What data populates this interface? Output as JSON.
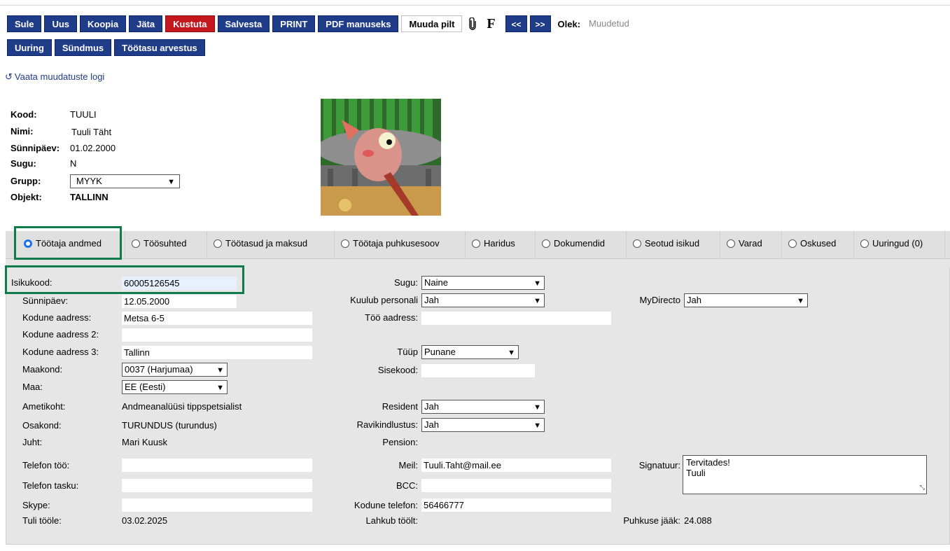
{
  "toolbar": {
    "row1": [
      "Sule",
      "Uus",
      "Koopia",
      "Jäta",
      "Kustuta",
      "Salvesta",
      "PRINT",
      "PDF manuseks"
    ],
    "muuda_pilt": "Muuda pilt",
    "attach_icon": "paperclip-icon",
    "f_label": "F",
    "prev": "<<",
    "next": ">>",
    "olek_label": "Olek:",
    "olek_value": "Muudetud",
    "row2": [
      "Uuring",
      "Sündmus",
      "Töötasu arvestus"
    ]
  },
  "colors": {
    "primary": "#1f3c88",
    "danger": "#c4161c",
    "highlight": "#0f7a4b"
  },
  "log_link": {
    "icon": "history-icon",
    "label": "Vaata muudatuste logi"
  },
  "header": {
    "kood_label": "Kood:",
    "kood": "TUULI",
    "nimi_label": "Nimi:",
    "nimi": "Tuuli Täht",
    "sunnipaev_label": "Sünnipäev:",
    "sunnipaev": "01.02.2000",
    "sugu_label": "Sugu:",
    "sugu": "N",
    "grupp_label": "Grupp:",
    "grupp": "MYYK",
    "objekt_label": "Objekt:",
    "objekt": "TALLINN"
  },
  "tabs": [
    {
      "label": "Töötaja andmed",
      "selected": true
    },
    {
      "label": "Töösuhted",
      "selected": false
    },
    {
      "label": "Töötasud ja maksud",
      "selected": false
    },
    {
      "label": "Töötaja puhkusesoov",
      "selected": false
    },
    {
      "label": "Haridus",
      "selected": false
    },
    {
      "label": "Dokumendid",
      "selected": false
    },
    {
      "label": "Seotud isikud",
      "selected": false
    },
    {
      "label": "Varad",
      "selected": false
    },
    {
      "label": "Oskused",
      "selected": false
    },
    {
      "label": "Uuringud (0)",
      "selected": false
    }
  ],
  "form": {
    "isikukood_label": "Isikukood:",
    "isikukood": "60005126545",
    "sunnipaev_label": "Sünnipäev:",
    "sunnipaev": "12.05.2000",
    "kodune_aadress_label": "Kodune aadress:",
    "kodune_aadress": "Metsa 6-5",
    "kodune_aadress2_label": "Kodune aadress 2:",
    "kodune_aadress2": "",
    "kodune_aadress3_label": "Kodune aadress 3:",
    "kodune_aadress3": "Tallinn",
    "maakond_label": "Maakond:",
    "maakond": "0037 (Harjumaa)",
    "maa_label": "Maa:",
    "maa": "EE (Eesti)",
    "ametikoht_label": "Ametikoht:",
    "ametikoht": "Andmeanalüüsi tippspetsialist",
    "osakond_label": "Osakond:",
    "osakond": "TURUNDUS (turundus)",
    "juht_label": "Juht:",
    "juht": "Mari Kuusk",
    "telefon_too_label": "Telefon töö:",
    "telefon_too": "",
    "telefon_tasku_label": "Telefon tasku:",
    "telefon_tasku": "",
    "skype_label": "Skype:",
    "skype": "",
    "tuli_toole_label": "Tuli tööle:",
    "tuli_toole": "03.02.2025",
    "sugu_label": "Sugu:",
    "sugu": "Naine",
    "kuulub_personali_label": "Kuulub personali",
    "kuulub_personali": "Jah",
    "too_aadress_label": "Töö aadress:",
    "too_aadress": "",
    "tyyp_label": "Tüüp",
    "tyyp": "Punane",
    "sisekood_label": "Sisekood:",
    "sisekood": "",
    "resident_label": "Resident",
    "resident": "Jah",
    "ravikindlustus_label": "Ravikindlustus:",
    "ravikindlustus": "Jah",
    "pension_label": "Pension:",
    "meil_label": "Meil:",
    "meil": "Tuuli.Taht@mail.ee",
    "bcc_label": "BCC:",
    "bcc": "",
    "kodune_telefon_label": "Kodune telefon:",
    "kodune_telefon": "56466777",
    "lahkub_label": "Lahkub töölt:",
    "mydirecto_label": "MyDirecto",
    "mydirecto": "Jah",
    "signatuur_label": "Signatuur:",
    "signatuur": "Tervitades!\nTuuli",
    "puhkuse_jaak_label": "Puhkuse jääk:",
    "puhkuse_jaak": "24.088"
  }
}
